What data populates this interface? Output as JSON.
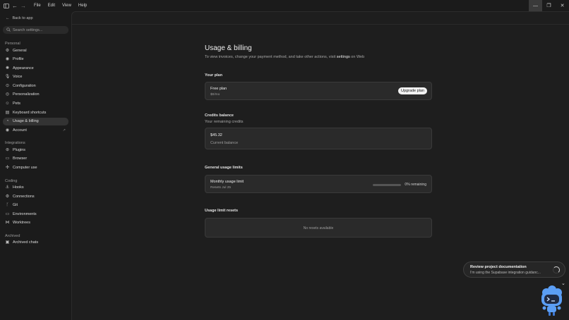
{
  "menubar": {
    "items": [
      "File",
      "Edit",
      "View",
      "Help"
    ]
  },
  "window_controls": {
    "minimize": "—",
    "restore": "❐",
    "close": "✕"
  },
  "sidebar": {
    "back_label": "Back to app",
    "search_placeholder": "Search settings...",
    "sections": [
      {
        "title": "Personal",
        "items": [
          {
            "label": "General",
            "icon": "gear-icon"
          },
          {
            "label": "Profile",
            "icon": "user-icon"
          },
          {
            "label": "Appearance",
            "icon": "palette-icon"
          },
          {
            "label": "Voice",
            "icon": "microphone-icon"
          },
          {
            "label": "Configuration",
            "icon": "sliders-icon"
          },
          {
            "label": "Personalization",
            "icon": "sparkle-icon"
          },
          {
            "label": "Pets",
            "icon": "paw-icon"
          },
          {
            "label": "Keyboard shortcuts",
            "icon": "keyboard-icon"
          },
          {
            "label": "Usage & billing",
            "icon": "gauge-icon",
            "active": true
          },
          {
            "label": "Account",
            "icon": "account-icon",
            "external": true
          }
        ]
      },
      {
        "title": "Integrations",
        "items": [
          {
            "label": "Plugins",
            "icon": "plugin-icon"
          },
          {
            "label": "Browser",
            "icon": "browser-icon"
          },
          {
            "label": "Computer use",
            "icon": "cursor-icon"
          }
        ]
      },
      {
        "title": "Coding",
        "items": [
          {
            "label": "Hooks",
            "icon": "hook-icon"
          },
          {
            "label": "Connections",
            "icon": "connection-icon"
          },
          {
            "label": "Git",
            "icon": "git-branch-icon"
          },
          {
            "label": "Environments",
            "icon": "monitor-icon"
          },
          {
            "label": "Worktrees",
            "icon": "tree-icon"
          }
        ]
      },
      {
        "title": "Archived",
        "items": [
          {
            "label": "Archived chats",
            "icon": "archive-icon"
          }
        ]
      }
    ]
  },
  "main": {
    "title": "Usage & billing",
    "subtitle_prefix": "To view invoices, change your payment method, and take other actions, visit ",
    "subtitle_link": "settings",
    "subtitle_suffix": " on Web",
    "your_plan": {
      "label": "Your plan",
      "plan_name": "Free plan",
      "plan_price": "$0/mo",
      "upgrade_label": "Upgrade plan"
    },
    "credits": {
      "label": "Credits balance",
      "sub": "Your remaining credits",
      "amount": "$45.32",
      "amount_label": "Current balance"
    },
    "usage_limits": {
      "label": "General usage limits",
      "limit_title": "Monthly usage limit",
      "limit_sub": "Resets Jul 25",
      "remaining_text": "0% remaining",
      "remaining_fraction": 0.0
    },
    "resets": {
      "label": "Usage limit resets",
      "empty_text": "No resets available"
    }
  },
  "toast": {
    "title": "Review project documentation",
    "body": "I'm using the Supabase integration guidanc..."
  },
  "colors": {
    "background": "#1b1b1b",
    "panel": "#1e1e1e",
    "card": "#2a2a2a",
    "active_item": "#333333",
    "button_bg": "#f2f2f2",
    "mascot_blue": "#5b9ef5"
  }
}
